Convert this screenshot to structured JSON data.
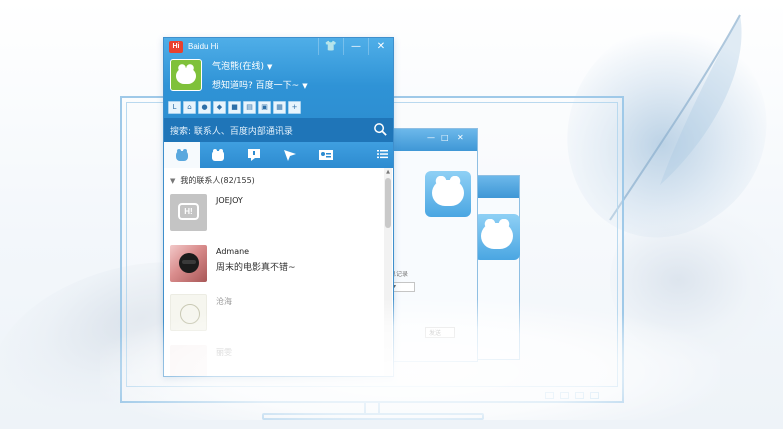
{
  "window": {
    "title": "Baidu Hi",
    "logo_text": "Hi",
    "controls": {
      "skin": "skin-icon",
      "minimize": "—",
      "close": "✕"
    }
  },
  "profile": {
    "name": "气泡熊(在线)",
    "signature": "想知道吗? 百度一下~"
  },
  "search": {
    "placeholder": "搜索: 联系人、百度内部通讯录"
  },
  "tabs": [
    {
      "name": "contacts",
      "icon": "bubble-icon",
      "active": true
    },
    {
      "name": "groups",
      "icon": "group-icon",
      "active": false
    },
    {
      "name": "messages",
      "icon": "message-icon",
      "active": false
    },
    {
      "name": "send",
      "icon": "send-icon",
      "active": false
    },
    {
      "name": "card",
      "icon": "card-icon",
      "active": false
    }
  ],
  "contacts": {
    "group_label": "我的联系人",
    "group_count": "(82/155)",
    "items": [
      {
        "name": "JOEJOY",
        "message": ""
      },
      {
        "name": "Admane",
        "message": "周末的电影真不错~"
      },
      {
        "name": "沧海",
        "message": ""
      },
      {
        "name": "丽雯",
        "message": ""
      }
    ]
  },
  "background_window": {
    "caption_fragment": "消息记录",
    "select_label": "▾",
    "button_label": "发送"
  },
  "colors": {
    "title_blue": "#2f93d6",
    "search_blue": "#1f75b8",
    "monitor_outline": "#9fc9e8",
    "logo_red": "#e8412f"
  }
}
